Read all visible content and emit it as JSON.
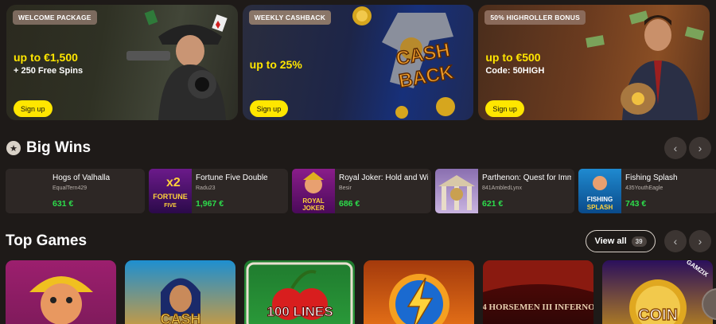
{
  "banners": [
    {
      "badge": "WELCOME PACKAGE",
      "headline": "up to €1,500",
      "sub": "+ 250 Free Spins",
      "cta": "Sign up"
    },
    {
      "badge": "WEEKLY CASHBACK",
      "headline": "up to 25%",
      "sub": "",
      "cta": "Sign up",
      "art_text_1": "CASH",
      "art_text_2": "BACK"
    },
    {
      "badge": "50% HIGHROLLER BONUS",
      "headline": "up to €500",
      "sub": "Code: 50HIGH",
      "cta": "Sign up"
    }
  ],
  "big_wins": {
    "title": "Big Wins",
    "items": [
      {
        "game": "Hogs of Valhalla",
        "user": "EqualTern429",
        "amount": "631 €"
      },
      {
        "game": "Fortune Five Double",
        "user": "Radu23",
        "amount": "1,967 €",
        "thumb_text_1": "x2",
        "thumb_text_2": "FORTUNE",
        "thumb_text_3": "FIVE"
      },
      {
        "game": "Royal Joker: Hold and Win",
        "user": "Besir",
        "amount": "686 €",
        "thumb_text_1": "ROYAL",
        "thumb_text_2": "JOKER"
      },
      {
        "game": "Parthenon: Quest for Immortality",
        "user": "841AmbledLynx",
        "amount": "621 €"
      },
      {
        "game": "Fishing Splash",
        "user": "435YouthEagle",
        "amount": "743 €",
        "thumb_text_1": "FISHING",
        "thumb_text_2": "SPLASH"
      }
    ]
  },
  "top_games": {
    "title": "Top Games",
    "view_all": "View all",
    "count": "39",
    "items": [
      {
        "art_text": ""
      },
      {
        "art_text": "CASH"
      },
      {
        "art_text": "100 LINES"
      },
      {
        "art_text": ""
      },
      {
        "art_text": "4 HORSEMEN III INFERNO"
      },
      {
        "art_text": "COIN",
        "brand": "GAMZIX"
      }
    ]
  },
  "nav": {
    "prev": "‹",
    "next": "›"
  },
  "icons": {
    "section": "star-icon",
    "prev": "chevron-left-icon",
    "next": "chevron-right-icon"
  },
  "colors": {
    "accent": "#ffe600",
    "win_amount": "#2ddc4b",
    "background": "#1e1a18"
  }
}
